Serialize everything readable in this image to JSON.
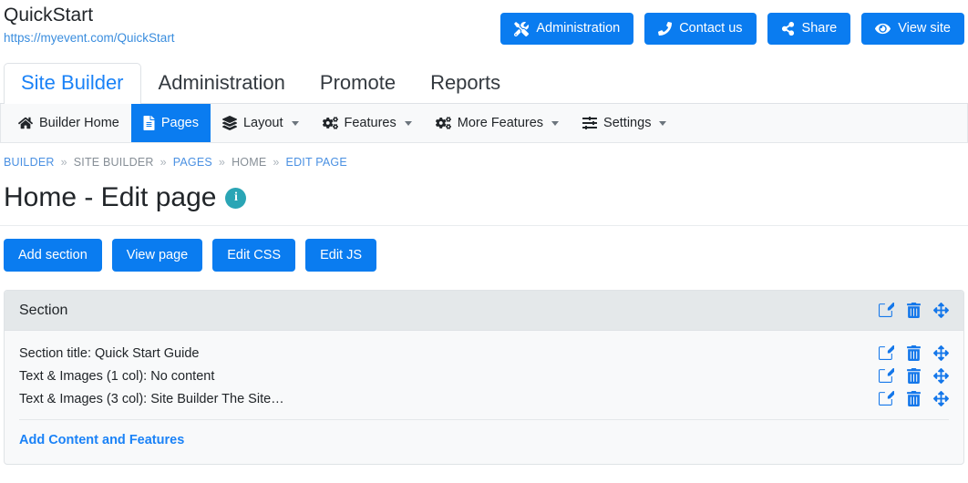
{
  "header": {
    "site_title": "QuickStart",
    "site_url": "https://myevent.com/QuickStart",
    "actions": [
      {
        "label": "Administration",
        "icon": "tools-icon"
      },
      {
        "label": "Contact us",
        "icon": "phone-icon"
      },
      {
        "label": "Share",
        "icon": "share-icon"
      },
      {
        "label": "View site",
        "icon": "eye-icon"
      }
    ]
  },
  "tabs": [
    {
      "label": "Site Builder",
      "active": true
    },
    {
      "label": "Administration",
      "active": false
    },
    {
      "label": "Promote",
      "active": false
    },
    {
      "label": "Reports",
      "active": false
    }
  ],
  "subnav": [
    {
      "label": "Builder Home",
      "icon": "home-icon",
      "active": false,
      "caret": false
    },
    {
      "label": "Pages",
      "icon": "file-icon",
      "active": true,
      "caret": false
    },
    {
      "label": "Layout",
      "icon": "layers-icon",
      "active": false,
      "caret": true
    },
    {
      "label": "Features",
      "icon": "cogs-icon",
      "active": false,
      "caret": true
    },
    {
      "label": "More Features",
      "icon": "cogs-icon",
      "active": false,
      "caret": true
    },
    {
      "label": "Settings",
      "icon": "sliders-icon",
      "active": false,
      "caret": true
    }
  ],
  "breadcrumb": [
    {
      "label": "BUILDER",
      "link": true
    },
    {
      "label": "SITE BUILDER",
      "link": false
    },
    {
      "label": "PAGES",
      "link": true
    },
    {
      "label": "HOME",
      "link": false
    },
    {
      "label": "EDIT PAGE",
      "link": true
    }
  ],
  "breadcrumb_separator": "»",
  "page": {
    "title": "Home - Edit page",
    "info_badge": "i"
  },
  "page_actions": [
    {
      "label": "Add section"
    },
    {
      "label": "View page"
    },
    {
      "label": "Edit CSS"
    },
    {
      "label": "Edit JS"
    }
  ],
  "section_card": {
    "header_title": "Section",
    "rows": [
      {
        "label": "Section title: Quick Start Guide"
      },
      {
        "label": "Text & Images (1 col): No content"
      },
      {
        "label": "Text & Images (3 col): Site Builder The Site…"
      }
    ],
    "add_content_label": "Add Content and Features",
    "row_icons": [
      "edit-icon",
      "delete-icon",
      "move-icon"
    ]
  },
  "colors": {
    "primary_blue": "#0a7cf0",
    "link_blue": "#1a82f7",
    "info_teal": "#2aa5b5",
    "card_header_gray": "#e4e8ea",
    "card_body_gray": "#f8f9fa"
  }
}
